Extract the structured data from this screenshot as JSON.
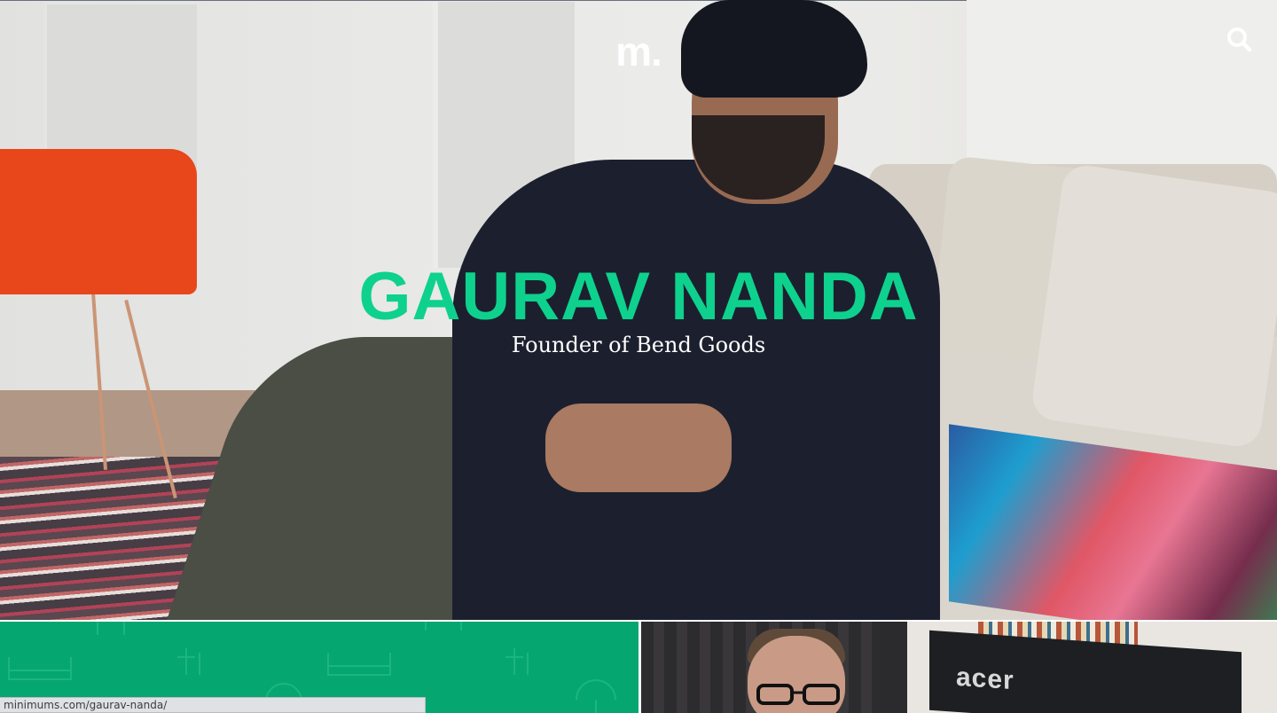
{
  "header": {
    "logo": "m.",
    "search_icon": "search-icon"
  },
  "hero": {
    "title": "GAURAV NANDA",
    "subtitle": "Founder of Bend Goods",
    "title_color": "#0ed18e"
  },
  "cards": {
    "left_bg": "#06a671",
    "laptop_brand": "acer"
  },
  "status_bar": {
    "url": "minimums.com/gaurav-nanda/"
  }
}
